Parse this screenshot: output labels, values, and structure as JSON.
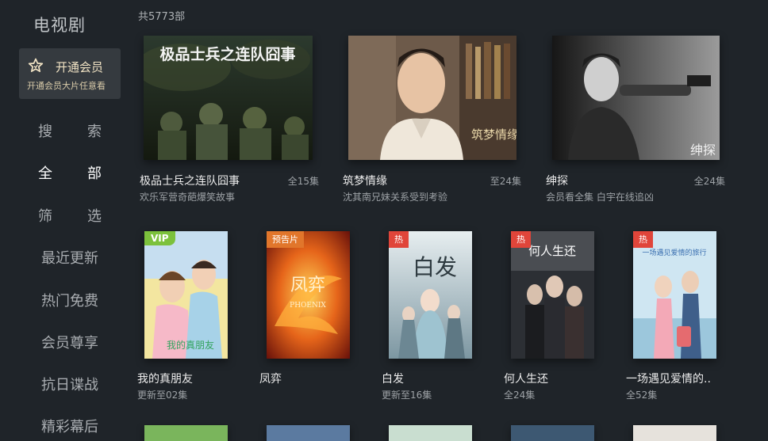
{
  "app": {
    "title": "电视剧"
  },
  "vip": {
    "label": "开通会员",
    "subtitle": "开通会员大片任意看"
  },
  "nav": [
    {
      "label": "搜索",
      "active": false
    },
    {
      "label": "全部",
      "active": true
    },
    {
      "label": "筛选",
      "active": false
    },
    {
      "label": "最近更新",
      "active": false
    },
    {
      "label": "热门免费",
      "active": false
    },
    {
      "label": "会员尊享",
      "active": false
    },
    {
      "label": "抗日谍战",
      "active": false
    },
    {
      "label": "精彩幕后",
      "active": false
    }
  ],
  "total": "共5773部",
  "row1": [
    {
      "title": "极品士兵之连队囧事",
      "count": "全15集",
      "desc": "欢乐军营奇葩爆笑故事",
      "poster_text": "极品士兵之连队囧事"
    },
    {
      "title": "筑梦情缘",
      "count": "至24集",
      "desc": "沈其南兄妹关系受到考验",
      "poster_text": "筑梦情缘"
    },
    {
      "title": "绅探",
      "count": "全24集",
      "desc": "会员看全集 白宇在线追凶",
      "poster_text": "绅探"
    }
  ],
  "row2": [
    {
      "title": "我的真朋友",
      "sub": "更新至02集",
      "badge": "VIP",
      "poster_text": "我的真朋友"
    },
    {
      "title": "凤弈",
      "sub": "",
      "badge": "预告片",
      "poster_text": "凤弈",
      "poster_text2": "PHOENIX"
    },
    {
      "title": "白发",
      "sub": "更新至16集",
      "badge": "热",
      "poster_text": "白发"
    },
    {
      "title": "何人生还",
      "sub": "全24集",
      "badge": "热",
      "poster_text": "何人生还"
    },
    {
      "title": "一场遇见爱情的..",
      "sub": "全52集",
      "badge": "热",
      "poster_text": "一场遇见爱情的旅行"
    }
  ],
  "colors": {
    "background": "#1f2429",
    "vip_gold": "#f1e3c4",
    "badge_vip": "#7cc13c",
    "badge_pre": "#e1762b",
    "badge_hot": "#e0453a"
  }
}
